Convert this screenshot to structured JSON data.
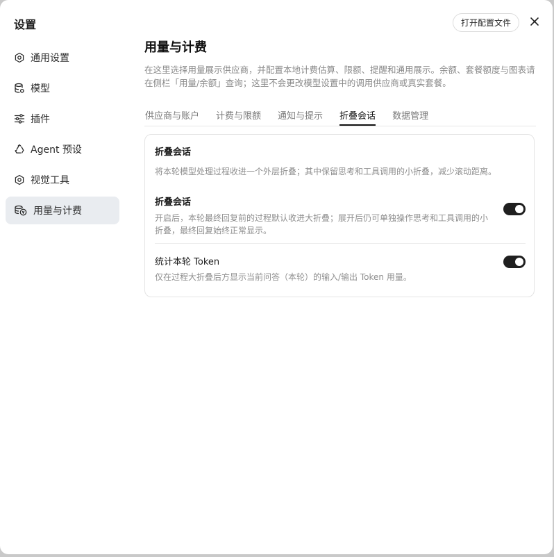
{
  "sidebar": {
    "title": "设置",
    "items": [
      {
        "label": "通用设置",
        "icon": "gear-icon"
      },
      {
        "label": "模型",
        "icon": "database-icon"
      },
      {
        "label": "插件",
        "icon": "sliders-icon"
      },
      {
        "label": "Agent 预设",
        "icon": "recycle-icon"
      },
      {
        "label": "视觉工具",
        "icon": "gear-icon"
      },
      {
        "label": "用量与计费",
        "icon": "coins-icon",
        "active": true
      }
    ]
  },
  "header": {
    "open_config_label": "打开配置文件",
    "close_icon": "close-icon"
  },
  "main": {
    "title": "用量与计费",
    "description": "在这里选择用量展示供应商，并配置本地计费估算、限额、提醒和通用展示。余额、套餐额度与图表请在侧栏「用量/余额」查询；这里不会更改模型设置中的调用供应商或真实套餐。",
    "tabs": [
      {
        "label": "供应商与账户"
      },
      {
        "label": "计费与限额"
      },
      {
        "label": "通知与提示"
      },
      {
        "label": "折叠会话",
        "active": true
      },
      {
        "label": "数据管理"
      }
    ],
    "card": {
      "title": "折叠会话",
      "description": "将本轮模型处理过程收进一个外层折叠；其中保留思考和工具调用的小折叠，减少滚动距离。",
      "settings": [
        {
          "name": "折叠会话",
          "help": "开启后，本轮最终回复前的过程默认收进大折叠；展开后仍可单独操作思考和工具调用的小折叠，最终回复始终正常显示。",
          "enabled": true
        },
        {
          "name": "统计本轮 Token",
          "help": "仅在过程大折叠后方显示当前问答（本轮）的输入/输出 Token 用量。",
          "enabled": true
        }
      ]
    }
  },
  "colors": {
    "active_nav_bg": "#e9ecf0",
    "toggle_on": "#1f1f1f",
    "muted_text": "#8e8e8e"
  }
}
